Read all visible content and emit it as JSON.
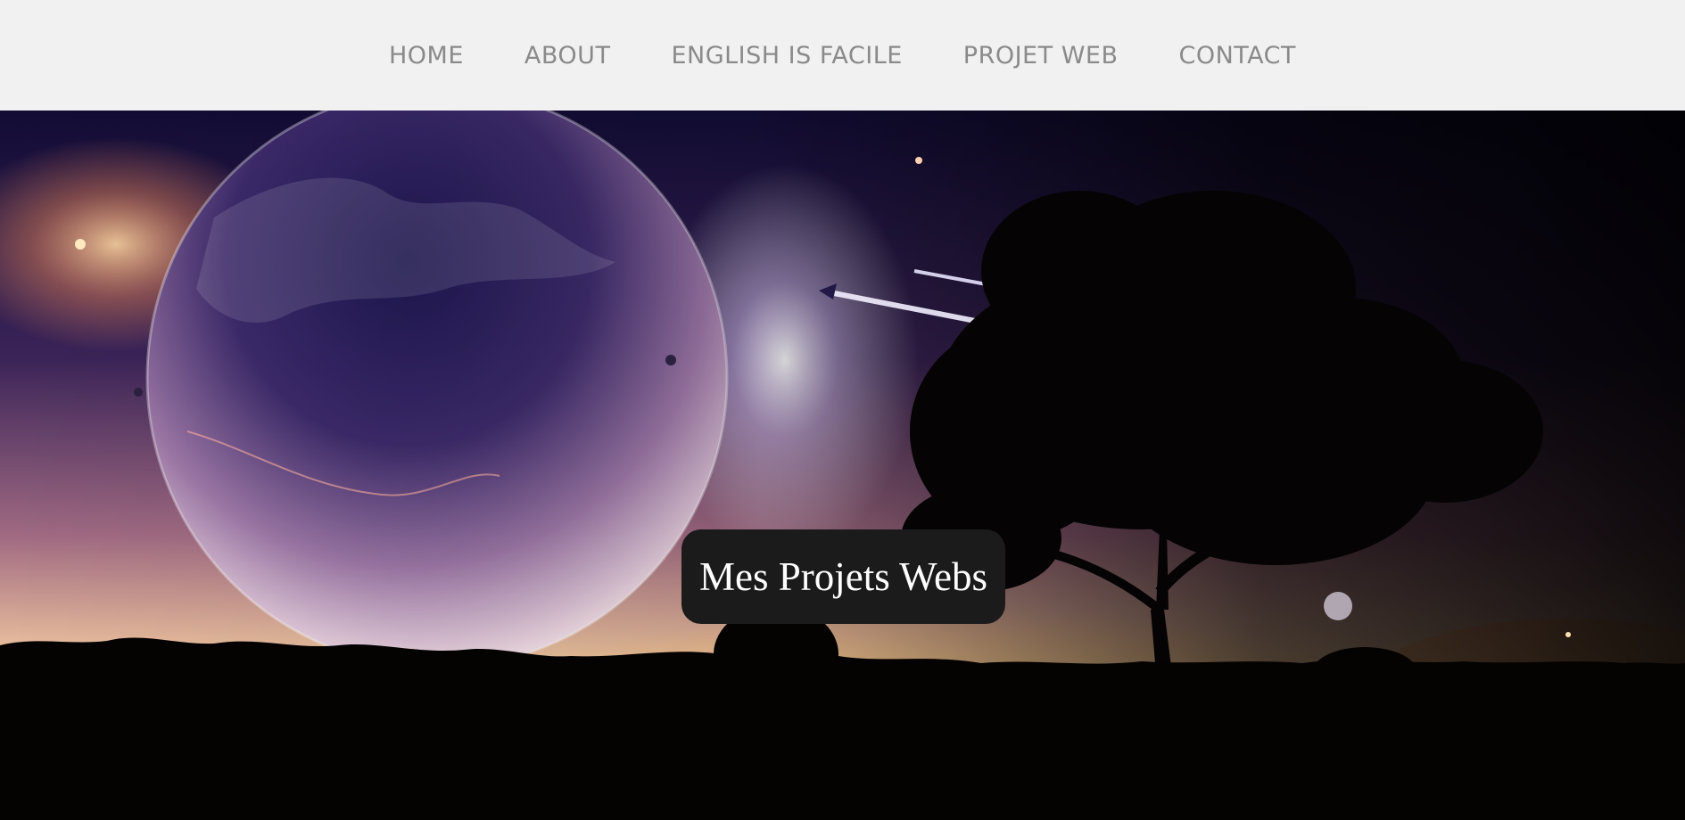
{
  "nav": {
    "items": [
      {
        "label": "HOME"
      },
      {
        "label": "ABOUT"
      },
      {
        "label": "ENGLISH IS FACILE"
      },
      {
        "label": "PROJET WEB"
      },
      {
        "label": "CONTACT"
      }
    ]
  },
  "hero": {
    "title": "Mes Projets Webs",
    "image": "space-landscape-planet-tree-silhouette"
  },
  "colors": {
    "nav_bg": "#f1f1f1",
    "nav_text": "#8a8a8a",
    "title_bg": "#1b1b1b",
    "title_text": "#ffffff"
  }
}
